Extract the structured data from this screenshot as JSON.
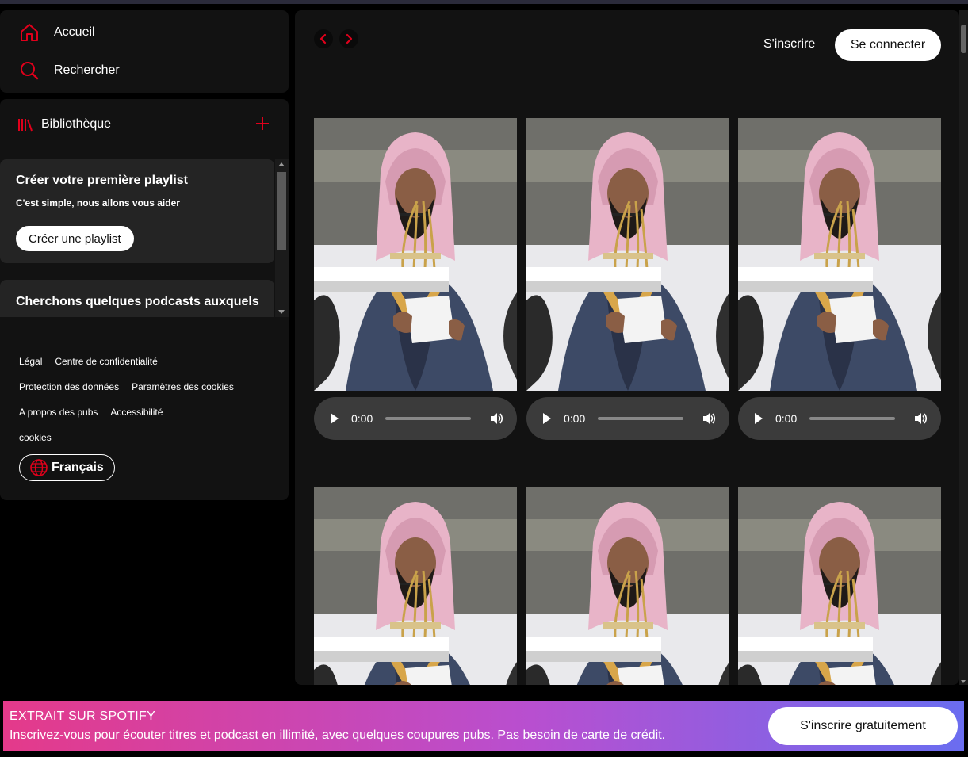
{
  "sidebar": {
    "nav": [
      {
        "label": "Accueil",
        "icon": "home-icon"
      },
      {
        "label": "Rechercher",
        "icon": "search-icon"
      }
    ],
    "library": {
      "label": "Bibliothèque",
      "icon": "library-icon",
      "add_icon": "plus-icon"
    },
    "cards": [
      {
        "title": "Créer votre première playlist",
        "subtitle": "C'est simple, nous allons vous aider",
        "button": "Créer une playlist"
      },
      {
        "title": "Cherchons quelques podcasts auxquels"
      }
    ],
    "footer_links": [
      [
        "Légal",
        "Centre de confidentialité"
      ],
      [
        "Protection des données",
        "Paramètres des cookies"
      ],
      [
        "A propos des pubs",
        "Accessibilité"
      ],
      [
        "cookies"
      ]
    ],
    "language": "Français"
  },
  "header": {
    "signup": "S'inscrire",
    "login": "Se connecter"
  },
  "players": [
    {
      "time": "0:00"
    },
    {
      "time": "0:00"
    },
    {
      "time": "0:00"
    }
  ],
  "banner": {
    "title": "EXTRAIT SUR SPOTIFY",
    "text": "Inscrivez-vous pour écouter titres et podcast en illimité, avec quelques coupures pubs. Pas besoin de carte de crédit.",
    "button": "S'inscrire gratuitement"
  },
  "colors": {
    "accent": "#e0001b",
    "background": "#000000",
    "panel": "#121212",
    "card": "#242424",
    "banner_start": "#e43a8a",
    "banner_end": "#6a6df0"
  }
}
